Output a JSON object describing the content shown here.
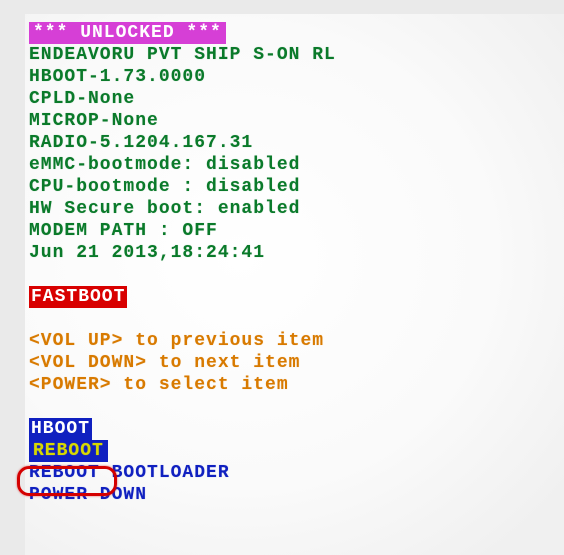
{
  "header": {
    "unlocked": "*** UNLOCKED ***"
  },
  "info": {
    "line1": "ENDEAVORU PVT SHIP S-ON RL",
    "line2": "HBOOT-1.73.0000",
    "line3": "CPLD-None",
    "line4": "MICROP-None",
    "line5": "RADIO-5.1204.167.31",
    "line6": "eMMC-bootmode: disabled",
    "line7": "CPU-bootmode : disabled",
    "line8": "HW Secure boot: enabled",
    "line9": "MODEM PATH : OFF",
    "line10": "Jun 21 2013,18:24:41"
  },
  "mode": {
    "label": "FASTBOOT"
  },
  "help": {
    "prev": "<VOL UP> to previous item",
    "next": "<VOL DOWN> to next item",
    "select": "<POWER> to select item"
  },
  "menu": {
    "hboot": "HBOOT",
    "reboot": "REBOOT",
    "reboot_bootloader": "REBOOT BOOTLOADER",
    "power_down": "POWER DOWN"
  }
}
